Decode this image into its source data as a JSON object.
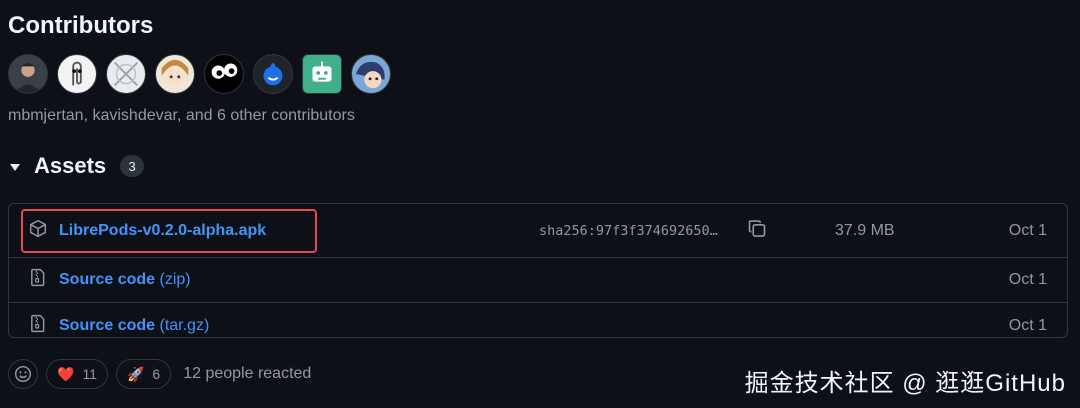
{
  "contributors": {
    "title": "Contributors",
    "summary": "mbmjertan, kavishdevar, and 6 other contributors",
    "avatars": [
      {
        "name": "avatar-photo-person",
        "bg": "#3a4048"
      },
      {
        "name": "avatar-paperclip",
        "bg": "#1e2228"
      },
      {
        "name": "avatar-geometric",
        "bg": "#e8ecef"
      },
      {
        "name": "avatar-anime-character",
        "bg": "#f0e6d8"
      },
      {
        "name": "avatar-cartoon-eyes",
        "bg": "#000000"
      },
      {
        "name": "avatar-blue-creature",
        "bg": "#1f242b"
      },
      {
        "name": "avatar-robot",
        "bg": "#3fb08a"
      },
      {
        "name": "avatar-illustration",
        "bg": "#7aa7d6"
      }
    ]
  },
  "assets": {
    "title": "Assets",
    "count": "3",
    "items": [
      {
        "name": "LibrePods-v0.2.0-alpha.apk",
        "sha": "sha256:97f3f374692650…",
        "size": "37.9 MB",
        "date": "Oct 1",
        "icon": "package-icon"
      },
      {
        "name": "Source code",
        "suffix": "(zip)",
        "date": "Oct 1",
        "icon": "file-zip-icon"
      },
      {
        "name": "Source code",
        "suffix": "(tar.gz)",
        "date": "Oct 1",
        "icon": "file-zip-icon"
      }
    ]
  },
  "reactions": {
    "heart_emoji": "❤️",
    "heart_count": "11",
    "rocket_emoji": "🚀",
    "rocket_count": "6",
    "summary": "12 people reacted"
  },
  "watermark": "掘金技术社区 @ 逛逛GitHub"
}
